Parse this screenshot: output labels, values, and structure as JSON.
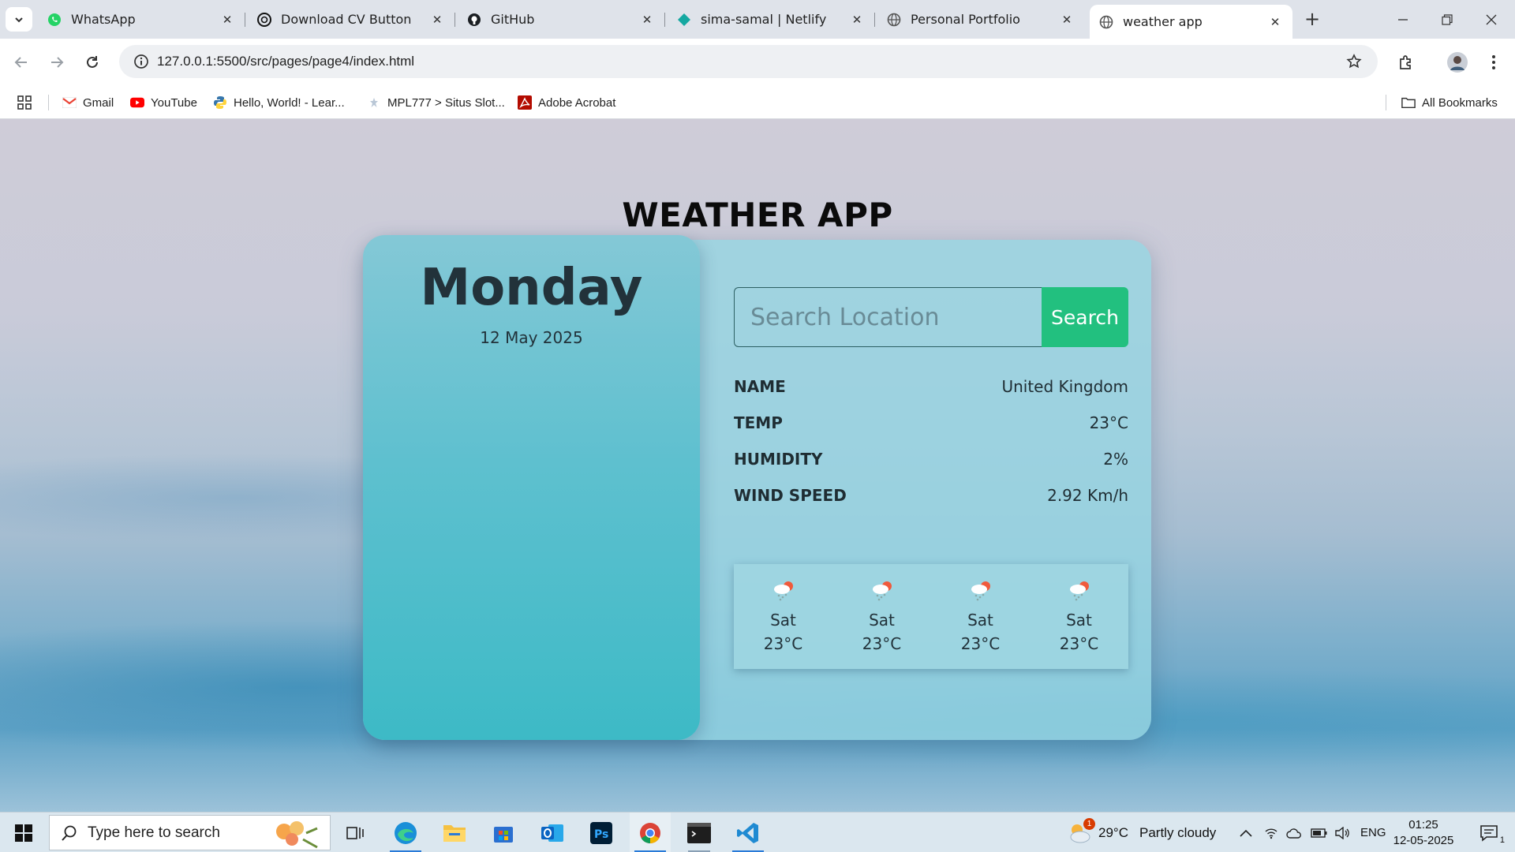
{
  "browser": {
    "tabs": [
      {
        "title": "WhatsApp",
        "icon": "whatsapp-icon"
      },
      {
        "title": "Download CV Button",
        "icon": "openai-icon"
      },
      {
        "title": "GitHub",
        "icon": "github-icon"
      },
      {
        "title": "sima-samal | Netlify",
        "icon": "netlify-icon"
      },
      {
        "title": "Personal Portfolio",
        "icon": "globe-icon"
      },
      {
        "title": "weather app",
        "icon": "globe-icon",
        "active": true
      }
    ],
    "url": "127.0.0.1:5500/src/pages/page4/index.html",
    "bookmarks": [
      {
        "label": "Gmail"
      },
      {
        "label": "YouTube"
      },
      {
        "label": "Hello, World! - Lear..."
      },
      {
        "label": "MPL777 > Situs Slot..."
      },
      {
        "label": "Adobe Acrobat"
      }
    ],
    "all_bookmarks": "All Bookmarks"
  },
  "app": {
    "title": "WEATHER APP",
    "day": "Monday",
    "date": "12 May 2025",
    "search": {
      "placeholder": "Search Location",
      "value": "",
      "button": "Search"
    },
    "details": [
      {
        "label": "NAME",
        "value": "United Kingdom"
      },
      {
        "label": "TEMP",
        "value": "23°C"
      },
      {
        "label": "HUMIDITY",
        "value": "2%"
      },
      {
        "label": "WIND SPEED",
        "value": "2.92 Km/h"
      }
    ],
    "forecast": [
      {
        "day": "Sat",
        "temp": "23°C",
        "icon": "snow-sun-icon"
      },
      {
        "day": "Sat",
        "temp": "23°C",
        "icon": "snow-sun-icon"
      },
      {
        "day": "Sat",
        "temp": "23°C",
        "icon": "snow-sun-icon"
      },
      {
        "day": "Sat",
        "temp": "23°C",
        "icon": "snow-sun-icon"
      }
    ]
  },
  "taskbar": {
    "search_placeholder": "Type here to search",
    "weather": {
      "temp": "29°C",
      "desc": "Partly cloudy",
      "badge": "1"
    },
    "language": "ENG",
    "time": "01:25",
    "date": "12-05-2025",
    "notification_count": "1"
  }
}
